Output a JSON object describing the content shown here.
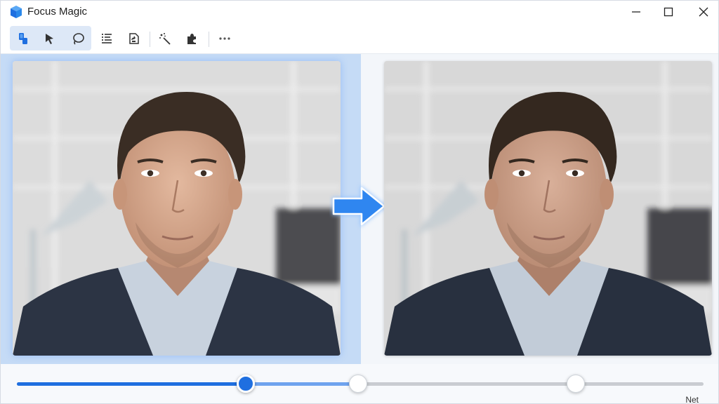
{
  "window": {
    "title": "Focus Magic",
    "controls": [
      "minimize-icon",
      "maximize-icon",
      "close-icon"
    ]
  },
  "toolbar": {
    "group_tools": [
      "paint-bucket-icon",
      "pointer-icon",
      "lasso-icon"
    ],
    "tools": [
      "list-icon",
      "document-export-icon",
      "magic-wand-icon",
      "puzzle-icon",
      "more-icon"
    ]
  },
  "images": {
    "before": "portrait-original",
    "after": "portrait-enhanced",
    "arrow": "arrow-right-icon"
  },
  "slider": {
    "main_value": 0.333,
    "range_end": 0.497,
    "marker": 0.814,
    "end_label": "Net",
    "fill_color": "#1f6fe0",
    "range_color": "#6fa3ee"
  },
  "colors": {
    "accent": "#1f6fe0",
    "selection": "#c5dbf6",
    "tool_group_bg": "#dde8f7"
  }
}
